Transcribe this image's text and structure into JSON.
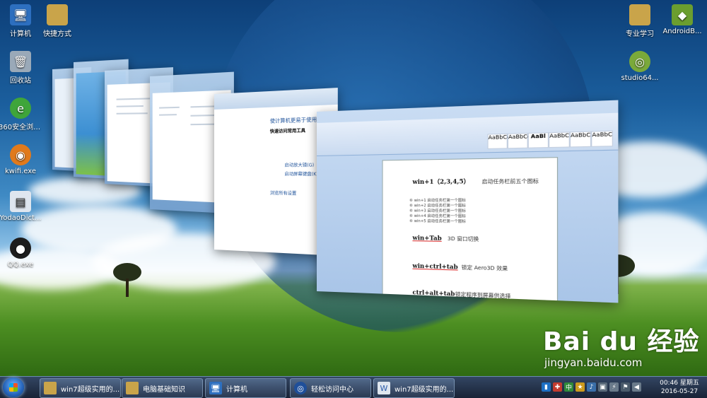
{
  "desktop": {
    "icons_left": [
      {
        "label": "计算机"
      },
      {
        "label": "快捷方式"
      },
      {
        "label": "回收站"
      },
      {
        "label": "360安全浏览器"
      },
      {
        "label": "kwifi.exe"
      },
      {
        "label": "YodaoDict..."
      },
      {
        "label": "QQ.exe"
      }
    ],
    "icons_right": [
      {
        "label": "专业学习"
      },
      {
        "label": "AndroidB..."
      },
      {
        "label": "studio64..."
      }
    ]
  },
  "document": {
    "lines": [
      {
        "head": "win+1（2,3,4,5）",
        "desc": "启动任务栏前五个图标"
      },
      {
        "head": "win+Tab",
        "desc": "3D 窗口切换"
      },
      {
        "head": "win+ctrl+tab",
        "desc": "锁定 Aero3D 效果"
      },
      {
        "head": "ctrl+alt+tab",
        "desc": "锁定程序到屏幕供选择"
      }
    ],
    "list": [
      "⑥ win+1 启动任务栏第一个图标",
      "⑥ win+2 启动任务栏第一个图标",
      "⑥ win+3 启动任务栏第一个图标",
      "⑥ win+4 启动任务栏第一个图标",
      "⑥ win+5 启动任务栏第一个图标"
    ],
    "styles": [
      "AaBbCcDc",
      "AaBbCcDc",
      "AaBl",
      "AaBbC",
      "AaBbC",
      "AaBbC"
    ]
  },
  "access_window": {
    "heading": "使计算机更易于使用",
    "subheading": "快速访问常用工具",
    "items": [
      "启动放大镜(G)",
      "启动屏幕键盘(K)"
    ],
    "section": "浏览所有设置"
  },
  "taskbar": {
    "buttons": [
      {
        "label": "win7超级实用的..."
      },
      {
        "label": "电脑基础知识"
      },
      {
        "label": "计算机"
      },
      {
        "label": "轻松访问中心"
      },
      {
        "label": "win7超级实用的..."
      }
    ],
    "clock_time": "00:46 星期五",
    "clock_date": "2016-05-27"
  },
  "watermark": {
    "logo": "Bai du 经验",
    "url": "jingyan.baidu.com"
  }
}
